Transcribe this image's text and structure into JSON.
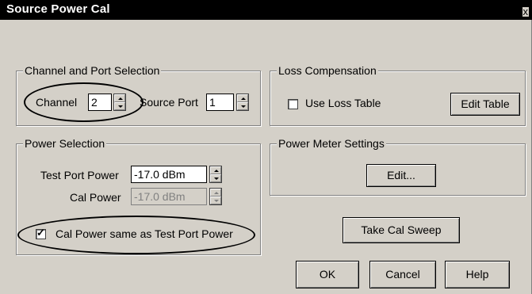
{
  "window": {
    "title": "Source Power Cal",
    "close_glyph": "x"
  },
  "channel_port": {
    "legend": "Channel and Port Selection",
    "channel_label": "Channel",
    "channel_value": "2",
    "source_port_label": "Source Port",
    "source_port_value": "1"
  },
  "loss_comp": {
    "legend": "Loss Compensation",
    "use_loss_table_label": "Use Loss Table",
    "use_loss_table_checked": false,
    "edit_table_label": "Edit Table"
  },
  "power_selection": {
    "legend": "Power Selection",
    "test_port_power_label": "Test Port Power",
    "test_port_power_value": "-17.0 dBm",
    "cal_power_label": "Cal Power",
    "cal_power_value": "-17.0 dBm",
    "cal_power_same_label": "Cal Power same as Test Port Power",
    "cal_power_same_checked": true
  },
  "power_meter": {
    "legend": "Power Meter Settings",
    "edit_label": "Edit..."
  },
  "actions": {
    "take_cal_sweep": "Take Cal Sweep",
    "ok": "OK",
    "cancel": "Cancel",
    "help": "Help"
  },
  "icons": [
    "spin-up-icon",
    "spin-down-icon",
    "checkmark-icon"
  ]
}
